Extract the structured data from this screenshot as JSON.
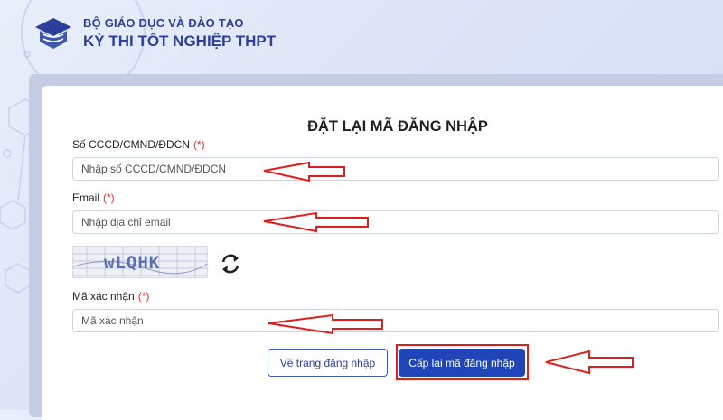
{
  "header": {
    "org_name": "BỘ GIÁO DỤC VÀ ĐÀO TẠO",
    "exam_name": "KỲ THI TỐT NGHIỆP THPT"
  },
  "form": {
    "title": "ĐẶT LẠI MÃ ĐĂNG NHẬP",
    "required_mark": "(*)",
    "id_number": {
      "label": "Số CCCD/CMND/ĐDCN",
      "placeholder": "Nhập số CCCD/CMND/ĐDCN",
      "value": ""
    },
    "email": {
      "label": "Email",
      "placeholder": "Nhập địa chỉ email",
      "value": ""
    },
    "captcha": {
      "text": "wLQHK"
    },
    "verify_code": {
      "label": "Mã xác nhận",
      "placeholder": "Mã xác nhận",
      "value": ""
    }
  },
  "buttons": {
    "back_label": "Về trang đăng nhập",
    "submit_label": "Cấp lại mã đăng nhập"
  },
  "colors": {
    "brand": "#2b3f9a",
    "primary_button": "#1f45b8",
    "required": "#e03030",
    "annotation": "#e01e1e"
  },
  "icons": [
    "ministry-logo-icon",
    "refresh-icon"
  ]
}
